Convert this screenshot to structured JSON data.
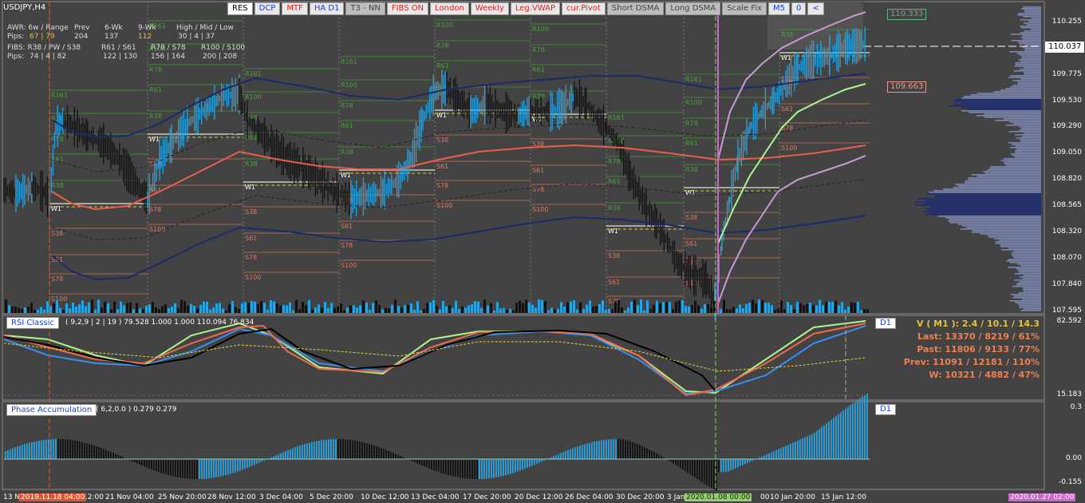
{
  "symbol": "USDJPY,H4",
  "toolbar": [
    {
      "label": "RES",
      "style": "white"
    },
    {
      "label": "DCP",
      "style": "blue"
    },
    {
      "label": "MTF",
      "style": "red"
    },
    {
      "label": "HA D1",
      "style": "blue"
    },
    {
      "label": "T3 - NN",
      "style": "grey"
    },
    {
      "label": "FIBS ON",
      "style": "red"
    },
    {
      "label": "London",
      "style": "red"
    },
    {
      "label": "Weekly",
      "style": "red"
    },
    {
      "label": "Leg.VWAP",
      "style": "red"
    },
    {
      "label": "cur.Pivot",
      "style": "red"
    },
    {
      "label": "Short DSMA",
      "style": "grey"
    },
    {
      "label": "Long DSMA",
      "style": "grey"
    },
    {
      "label": "Scale Fix",
      "style": "grey"
    },
    {
      "label": "M5",
      "style": "blue"
    },
    {
      "label": "0",
      "style": "blue"
    },
    {
      "label": "<",
      "style": "blue"
    }
  ],
  "info_panel": {
    "awr_label": "AWR: 6w / Range",
    "pips_label": "Pips:",
    "awr_value": "67 | 79",
    "prev_label": "Prev",
    "prev_value": "204",
    "wk6_label": "6-Wk",
    "wk6_value": "137",
    "wk9_label": "9-Wk",
    "wk9_value": "112",
    "hml_label": "High / Mid / Low",
    "hml_value": "30 | 4 | 37",
    "fibs_label": "FIBS: R38 / PW / S38",
    "fibs_pips": "Pips:",
    "fibs_value": "74 | 4 | 82",
    "r61_label": "R61 / S61",
    "r61_value": "122 | 130",
    "r78_label": "R78 / S78",
    "r78_value": "156 | 164",
    "r100_label": "R100 / S100",
    "r100_value": "200 | 208"
  },
  "price_axis": [
    "110.255",
    "110.037",
    "109.775",
    "109.530",
    "109.290",
    "109.050",
    "108.820",
    "108.565",
    "108.320",
    "108.070",
    "107.840",
    "107.595"
  ],
  "current_price": "110.037",
  "price_boxes": [
    {
      "label": "110.333",
      "color": "#5fb27a"
    },
    {
      "label": "109.663",
      "color": "#e79a8e"
    }
  ],
  "rsi": {
    "label": "RSI Classic",
    "params": "( 9,2,9 | 2 | 19 ) 79.528 1.000 1.000 110.094 76.834",
    "tag": "D1",
    "axis_top": "82.592",
    "axis_bottom": "15.183"
  },
  "stats": {
    "v": "V ( M1 ): 2.4 / 10.1 / 14.3",
    "last": "Last: 13370 / 8219 / 61%",
    "past": "Past: 11806 / 9133 / 77%",
    "prev": "Prev: 11091 / 12181 / 110%",
    "w": "W: 10321 / 4882 / 47%"
  },
  "phase": {
    "label": "Phase Accumulation",
    "params": "( 6,2,0.0 ) 0.279 0.279",
    "tag": "D1",
    "axis_top": "0.3",
    "axis_mid": "0.00",
    "axis_bottom": "-0.155"
  },
  "time_axis": [
    "13 N",
    "12:00",
    "21 Nov 04:00",
    "25 Nov 20:00",
    "28 Nov 12:00",
    "3 Dec 04:00",
    "5 Dec 20:00",
    "10 Dec 12:00",
    "13 Dec 04:00",
    "17 Dec 20:00",
    "20 Dec 12:00",
    "26 Dec 04:00",
    "30 Dec 20:00",
    "3 Jan",
    "00",
    "10 Jan 20:00",
    "15 Jan 12:00"
  ],
  "time_boxes": [
    {
      "label": "2019.11.18 04:00",
      "color": "#e05530"
    },
    {
      "label": "2020.01.08 00:00",
      "color": "#8fd16a"
    },
    {
      "label": "2020.01.27 02:00",
      "color": "#cc66cc"
    }
  ],
  "level_labels": [
    "R161",
    "R138",
    "R100",
    "R78",
    "R61",
    "R38",
    "W1",
    "S38",
    "S61",
    "S78",
    "S100",
    "S138",
    "S161",
    "S178",
    "S200",
    "R200",
    "R178"
  ]
}
